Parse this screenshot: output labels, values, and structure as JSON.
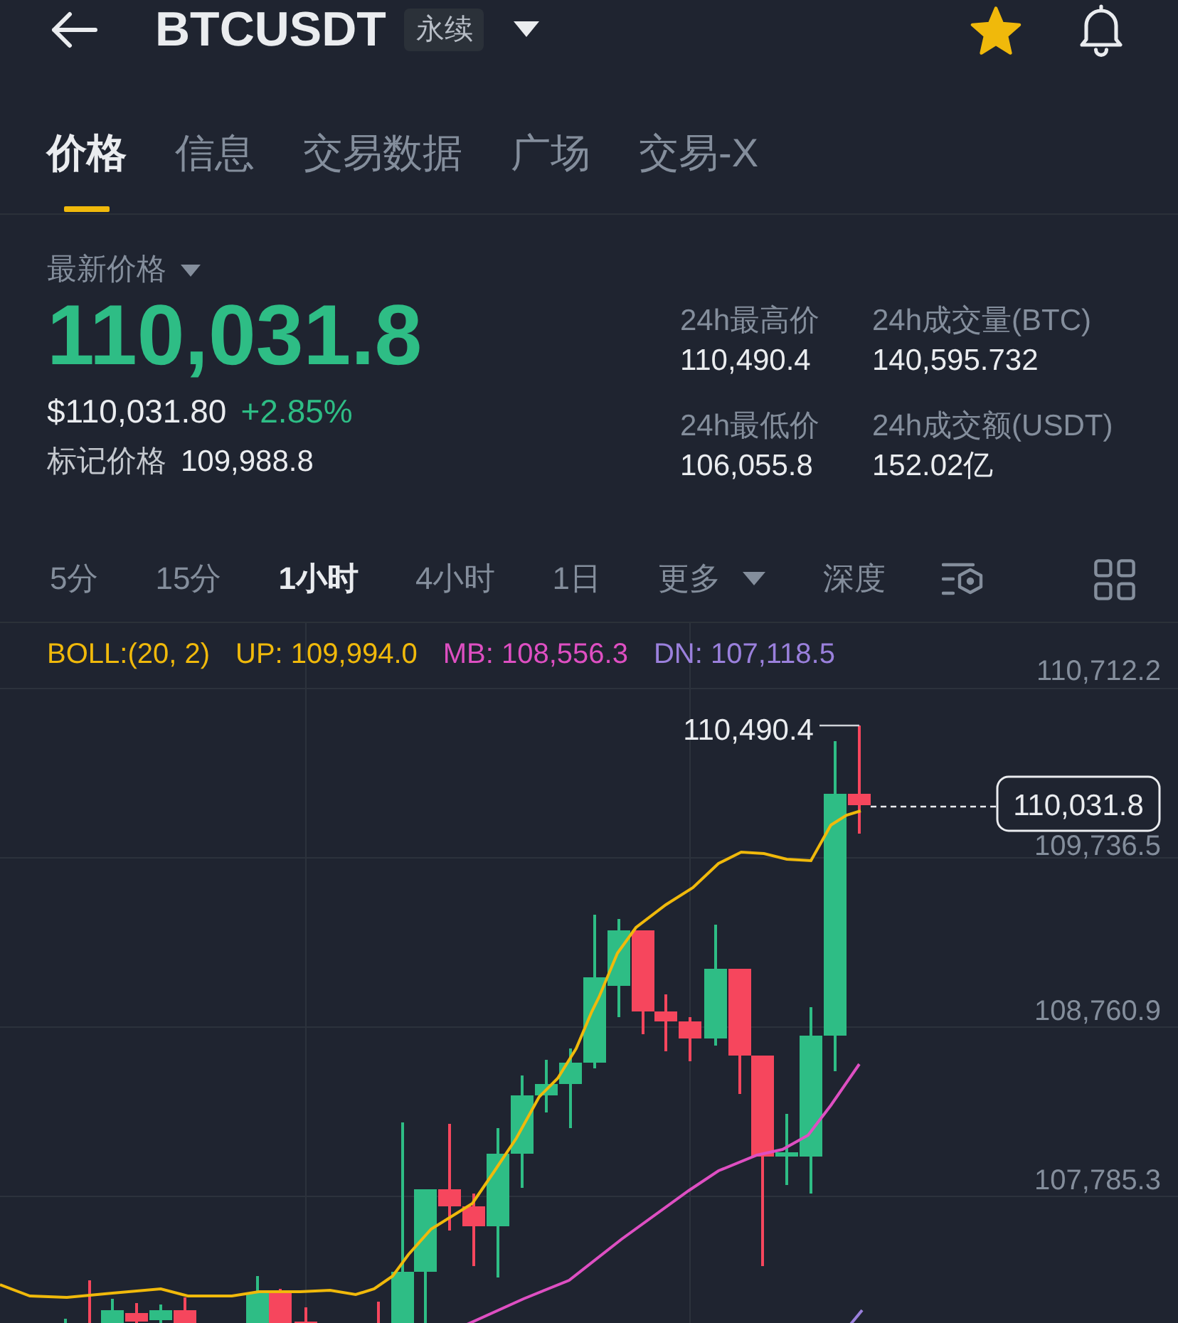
{
  "header": {
    "symbol": "BTCUSDT",
    "contract_tag": "永续",
    "favorite": true
  },
  "tabs": [
    {
      "label": "价格",
      "selected": true
    },
    {
      "label": "信息",
      "selected": false
    },
    {
      "label": "交易数据",
      "selected": false
    },
    {
      "label": "广场",
      "selected": false
    },
    {
      "label": "交易-X",
      "selected": false
    }
  ],
  "price": {
    "label": "最新价格",
    "last": "110,031.8",
    "rising": true,
    "usd": "$110,031.80",
    "change": "+2.85%",
    "mark_label": "标记价格",
    "mark": "109,988.8"
  },
  "stats": [
    {
      "label": "24h最高价",
      "value": "110,490.4"
    },
    {
      "label": "24h成交量(BTC)",
      "value": "140,595.732"
    },
    {
      "label": "24h最低价",
      "value": "106,055.8"
    },
    {
      "label": "24h成交额(USDT)",
      "value": "152.02亿"
    }
  ],
  "intervals": [
    {
      "label": "5分",
      "selected": false
    },
    {
      "label": "15分",
      "selected": false
    },
    {
      "label": "1小时",
      "selected": true
    },
    {
      "label": "4小时",
      "selected": false
    },
    {
      "label": "1日",
      "selected": false
    }
  ],
  "more_menu": {
    "label": "更多"
  },
  "depth_tab": {
    "label": "深度"
  },
  "chart": {
    "legend": [
      {
        "text": "BOLL:(20, 2)",
        "color": "#f0b90b"
      },
      {
        "text": "UP: 109,994.0",
        "color": "#f0b90b"
      },
      {
        "text": "MB: 108,556.3",
        "color": "#de4fc2"
      },
      {
        "text": "DN: 107,118.5",
        "color": "#9a80dc"
      }
    ],
    "y_labels": [
      "110,712.2",
      "109,736.5",
      "108,760.9",
      "107,785.3"
    ],
    "high_label": "110,490.4",
    "last_price_tag": "110,031.8"
  }
}
